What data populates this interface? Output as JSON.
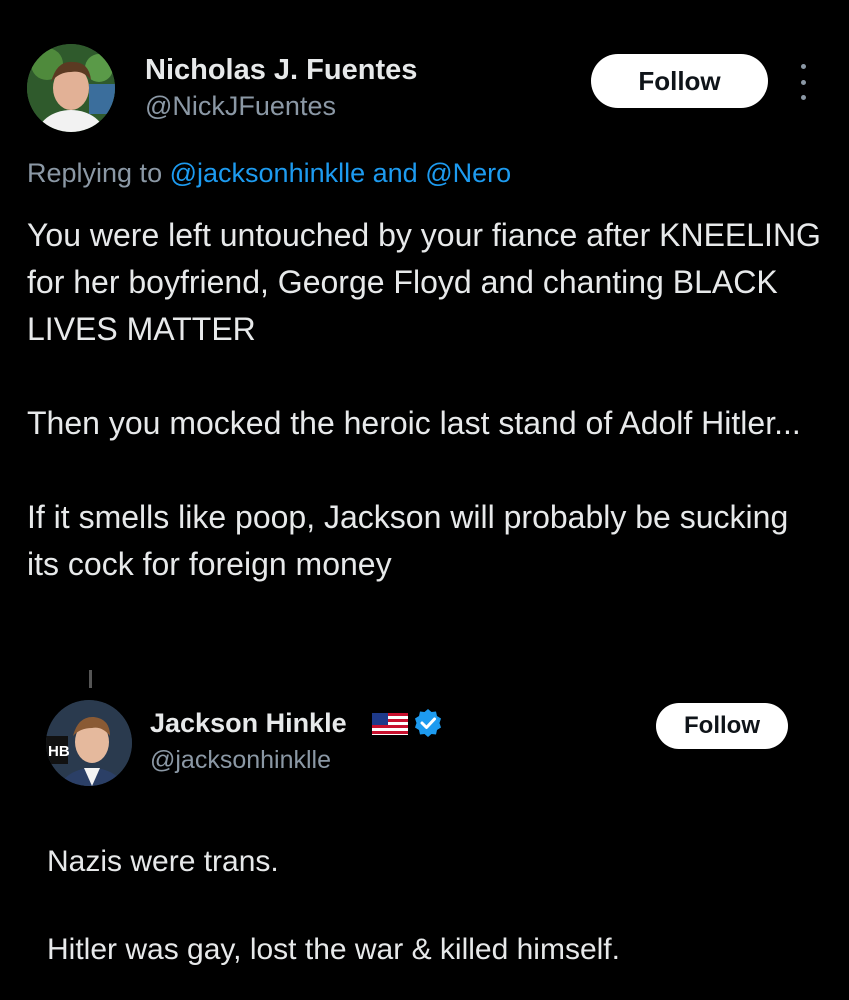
{
  "tweet": {
    "author": {
      "name": "Nicholas J. Fuentes",
      "handle": "@NickJFuentes"
    },
    "follow_label": "Follow",
    "replying": {
      "prefix": "Replying to",
      "mention1": "@jacksonhinklle",
      "conj": "and",
      "mention2": "@Nero"
    },
    "paragraphs": [
      "You were left untouched by your fiance after KNEELING for her boyfriend, George Floyd and chanting BLACK LIVES MATTER",
      "Then you mocked the heroic last stand of Adolf Hitler...",
      "If it smells like poop, Jackson will probably be sucking its cock for foreign money"
    ]
  },
  "quoted": {
    "author": {
      "name": "Jackson Hinkle",
      "handle": "@jacksonhinklle"
    },
    "follow_label": "Follow",
    "avatar_overlay": "HB",
    "paragraphs": [
      "Nazis were trans.",
      "Hitler was gay, lost the war & killed himself."
    ]
  },
  "colors": {
    "background": "#000000",
    "text": "#e7e9ea",
    "muted": "#8b98a5",
    "link": "#1d9bf0",
    "verified": "#1d9bf0"
  },
  "icons": [
    "more-options-icon",
    "us-flag-icon",
    "verified-badge-icon"
  ]
}
